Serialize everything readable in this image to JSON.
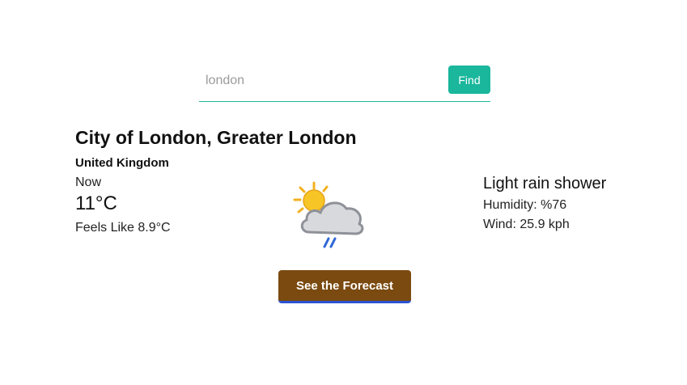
{
  "search": {
    "placeholder": "london",
    "value": "",
    "button_label": "Find"
  },
  "location": {
    "city": "City of London, Greater London",
    "country": "United Kingdom"
  },
  "current": {
    "now_label": "Now",
    "temperature": "11°C",
    "feels_like": "Feels Like 8.9°C",
    "condition": "Light rain shower",
    "humidity": "Humidity: %76",
    "wind": "Wind: 25.9 kph",
    "icon": "sun-cloud-rain-icon"
  },
  "actions": {
    "forecast_label": "See the Forecast"
  },
  "colors": {
    "accent": "#1ab79c",
    "forecast_button": "#7a4a10",
    "forecast_button_underline": "#2a54d4"
  }
}
